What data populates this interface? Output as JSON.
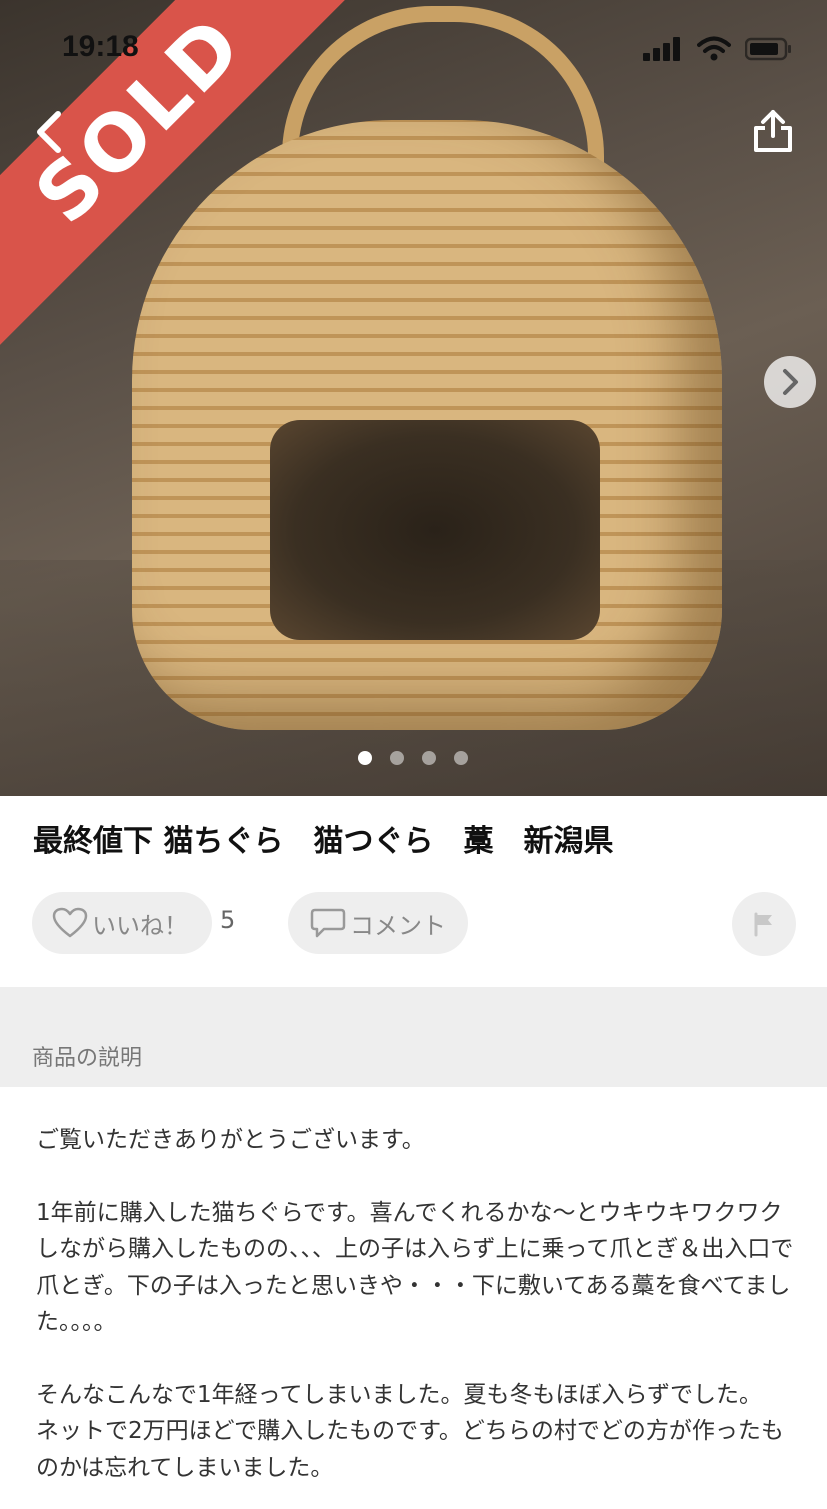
{
  "status_bar": {
    "time": "19:18"
  },
  "hero": {
    "sold_label": "SOLD",
    "back_icon": "chevron-left-icon",
    "share_icon": "share-icon",
    "next_icon": "chevron-right-icon",
    "image_count": 4,
    "active_index": 0
  },
  "product": {
    "title": "最終値下 猫ちぐら　猫つぐら　藁　新潟県",
    "like_label": "いいね！",
    "like_count": "5",
    "comment_label": "コメント"
  },
  "description": {
    "section_title": "商品の説明",
    "paragraphs": [
      "ご覧いただきありがとうございます。",
      "1年前に購入した猫ちぐらです。喜んでくれるかな〜とウキウキワクワクしながら購入したものの、、、上の子は入らず上に乗って爪とぎ＆出入口で爪とぎ。下の子は入ったと思いきや・・・下に敷いてある藁を食べてました。。。。",
      "そんなこんなで1年経ってしまいました。夏も冬もほぼ入らずでした。",
      "ネットで2万円ほどで購入したものです。どちらの村でどの方が作ったものかは忘れてしまいました。"
    ]
  },
  "colors": {
    "sold_band": "#d9544a",
    "pill_bg": "#eeeeee",
    "section_bg": "#eeeeee"
  }
}
